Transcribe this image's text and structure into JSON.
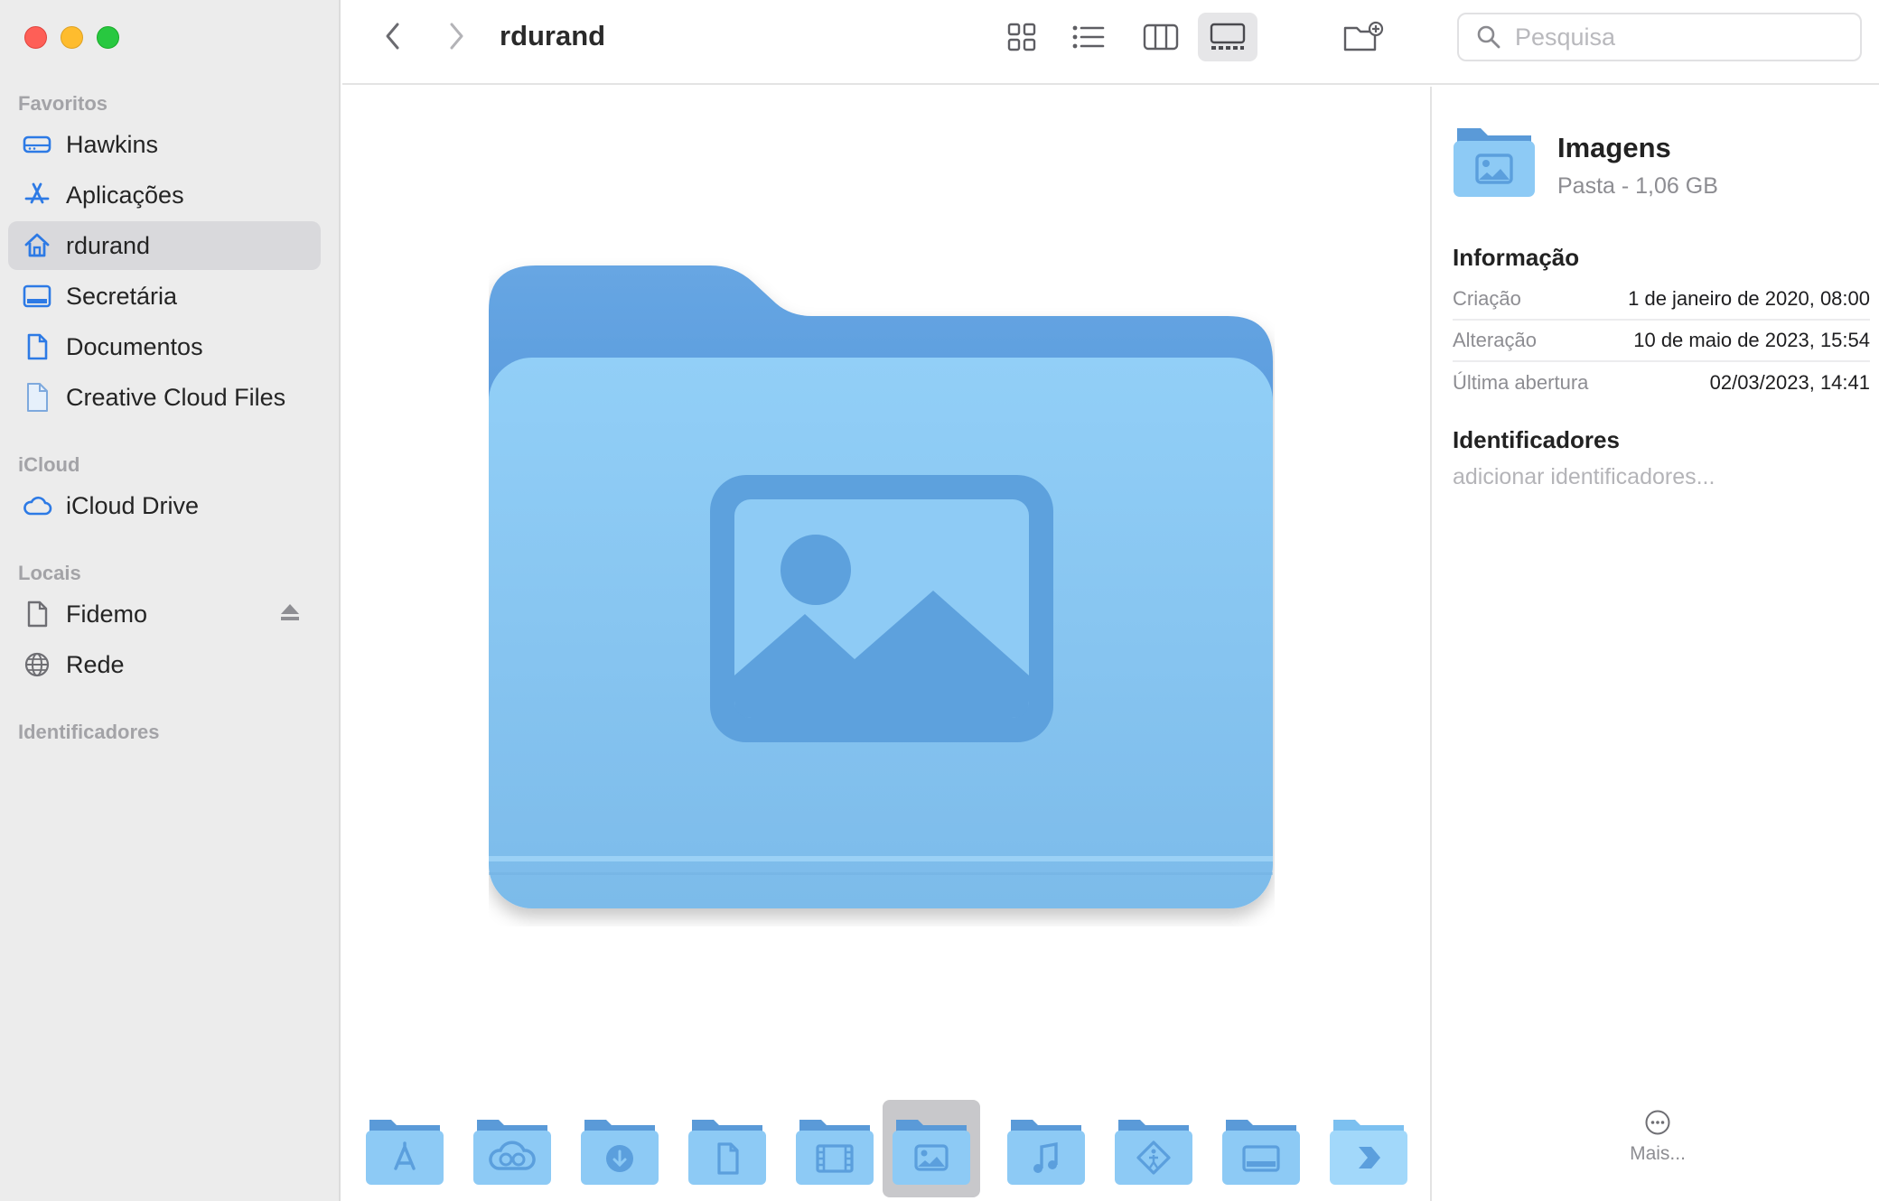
{
  "window": {
    "title": "rdurand"
  },
  "sidebar": {
    "favorites_header": "Favoritos",
    "favorites": [
      {
        "label": "Hawkins",
        "icon": "drive-icon"
      },
      {
        "label": "Aplicações",
        "icon": "applications-icon"
      },
      {
        "label": "rdurand",
        "icon": "home-icon",
        "selected": true
      },
      {
        "label": "Secretária",
        "icon": "desktop-icon"
      },
      {
        "label": "Documentos",
        "icon": "document-icon"
      },
      {
        "label": "Creative Cloud Files",
        "icon": "file-icon"
      }
    ],
    "icloud_header": "iCloud",
    "icloud": [
      {
        "label": "iCloud Drive",
        "icon": "cloud-icon"
      }
    ],
    "locations_header": "Locais",
    "locations": [
      {
        "label": "Fidemo",
        "icon": "document-icon",
        "eject": true
      },
      {
        "label": "Rede",
        "icon": "globe-icon"
      }
    ],
    "tags_header": "Identificadores"
  },
  "toolbar": {
    "search_placeholder": "Pesquisa",
    "views": [
      "icon-view",
      "list-view",
      "column-view",
      "gallery-view"
    ],
    "active_view": "gallery-view"
  },
  "inspector": {
    "name": "Imagens",
    "subtitle": "Pasta - 1,06 GB",
    "info_header": "Informação",
    "info": [
      {
        "key": "Criação",
        "value": "1 de janeiro de 2020, 08:00"
      },
      {
        "key": "Alteração",
        "value": "10 de maio de 2023, 15:54"
      },
      {
        "key": "Última abertura",
        "value": "02/03/2023, 14:41"
      }
    ],
    "tags_header": "Identificadores",
    "tags_placeholder": "adicionar identificadores...",
    "more_label": "Mais..."
  },
  "gallery": {
    "thumbnails": [
      "applications-folder",
      "creative-cloud-folder",
      "downloads-folder",
      "documents-folder",
      "movies-folder",
      "pictures-folder",
      "music-folder",
      "public-folder",
      "desktop-folder",
      "shortcut-folder"
    ],
    "selected": "pictures-folder"
  },
  "colors": {
    "accent": "#2d7ae5",
    "folder_back": "#5a9ad8",
    "folder_front": "#8dcaf5",
    "folder_glyph": "#5b9fdd",
    "sidebar_bg": "#ececec"
  }
}
